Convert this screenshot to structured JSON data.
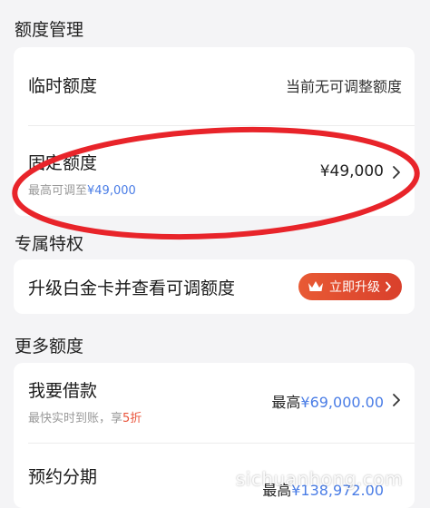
{
  "sections": {
    "quota_title": "额度管理",
    "privilege_title": "专属特权",
    "more_title": "更多额度"
  },
  "temp_quota": {
    "label": "临时额度",
    "status": "当前无可调整额度"
  },
  "fixed_quota": {
    "label": "固定额度",
    "sub_prefix": "最高可调至",
    "sub_value": "¥49,000",
    "amount": "¥49,000"
  },
  "privilege": {
    "label": "升级白金卡并查看可调额度",
    "button_label": "立即升级"
  },
  "borrow": {
    "label": "我要借款",
    "sub_prefix": "最快实时到账，享",
    "sub_highlight": "5折",
    "max_label": "最高",
    "max_value": "¥69,000.00"
  },
  "installment": {
    "label": "预约分期",
    "max_label": "最高",
    "max_value": "¥138,972.00"
  },
  "watermark": "sichuanhong.com",
  "colors": {
    "accent_blue": "#4a7de6",
    "accent_red": "#e9533a",
    "annotation_red": "#e8242a"
  },
  "icons": {
    "chevron": "chevron-right-icon",
    "crown": "crown-icon"
  }
}
